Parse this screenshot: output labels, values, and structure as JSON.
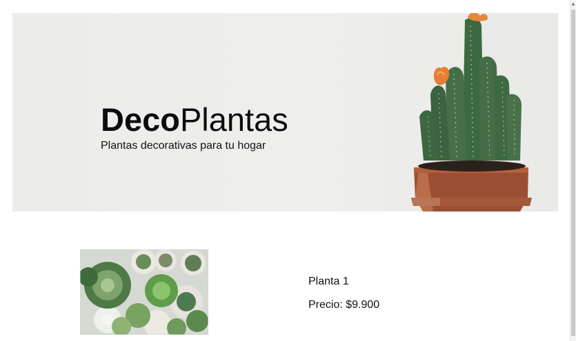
{
  "hero": {
    "brand_bold": "Deco",
    "brand_regular": "Plantas",
    "tagline": "Plantas decorativas para tu hogar"
  },
  "product": {
    "name": "Planta 1",
    "price": "Precio: $9.900"
  },
  "colors": {
    "hero_background": "#ececea",
    "pot": "#9e5133",
    "cactus": "#3f6a44",
    "flower": "#e9843a"
  },
  "icons": {
    "scroll_up": "arrow-up-icon"
  }
}
